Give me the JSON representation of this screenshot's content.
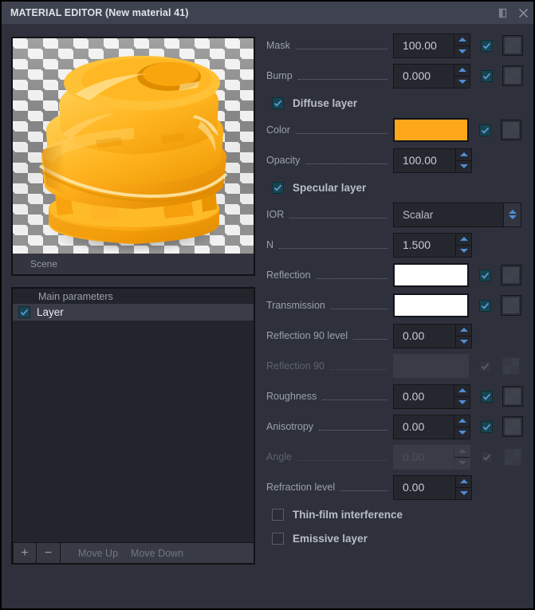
{
  "window": {
    "title": "MATERIAL EDITOR (New material 41)",
    "maximize_icon": "maximize-icon",
    "close_icon": "close-icon"
  },
  "preview": {
    "scene_label": "Scene",
    "object_color": "#FFA71A",
    "background": "checkerboard"
  },
  "layers_panel": {
    "header": "Main parameters",
    "items": [
      {
        "label": "Layer",
        "checked": true,
        "selected": true
      }
    ],
    "toolbar": {
      "add_label": "+",
      "remove_label": "−",
      "move_up_label": "Move Up",
      "move_down_label": "Move Down"
    }
  },
  "parameters": [
    {
      "kind": "spin",
      "label": "Mask",
      "value": "100.00",
      "checkbox": true,
      "texture": true,
      "enabled": true
    },
    {
      "kind": "spin",
      "label": "Bump",
      "value": "0.000",
      "checkbox": true,
      "texture": true,
      "enabled": true
    },
    {
      "kind": "section",
      "label": "Diffuse layer",
      "checked": true
    },
    {
      "kind": "color",
      "label": "Color",
      "color": "#FFA71A",
      "checkbox": true,
      "texture": true,
      "enabled": true
    },
    {
      "kind": "spin",
      "label": "Opacity",
      "value": "100.00",
      "checkbox": false,
      "texture": false,
      "enabled": true
    },
    {
      "kind": "section",
      "label": "Specular layer",
      "checked": true
    },
    {
      "kind": "combo",
      "label": "IOR",
      "value": "Scalar",
      "enabled": true
    },
    {
      "kind": "spin",
      "label": "N",
      "value": "1.500",
      "checkbox": false,
      "texture": false,
      "enabled": true
    },
    {
      "kind": "color",
      "label": "Reflection",
      "color": "#FFFFFF",
      "checkbox": true,
      "texture": true,
      "enabled": true
    },
    {
      "kind": "color",
      "label": "Transmission",
      "color": "#FFFFFF",
      "checkbox": true,
      "texture": true,
      "enabled": true
    },
    {
      "kind": "spin",
      "label": "Reflection 90 level",
      "value": "0.00",
      "checkbox": false,
      "texture": false,
      "enabled": true
    },
    {
      "kind": "color",
      "label": "Reflection 90",
      "color": "#393C46",
      "checkbox": true,
      "texture": true,
      "enabled": false
    },
    {
      "kind": "spin",
      "label": "Roughness",
      "value": "0.00",
      "checkbox": true,
      "texture": true,
      "enabled": true
    },
    {
      "kind": "spin",
      "label": "Anisotropy",
      "value": "0.00",
      "checkbox": true,
      "texture": true,
      "enabled": true
    },
    {
      "kind": "spin",
      "label": "Angle",
      "value": "0.00",
      "checkbox": true,
      "texture": true,
      "enabled": false
    },
    {
      "kind": "spin",
      "label": "Refraction level",
      "value": "0.00",
      "checkbox": false,
      "texture": false,
      "enabled": true
    },
    {
      "kind": "section",
      "label": "Thin-film interference",
      "checked": false
    },
    {
      "kind": "section",
      "label": "Emissive layer",
      "checked": false
    }
  ]
}
